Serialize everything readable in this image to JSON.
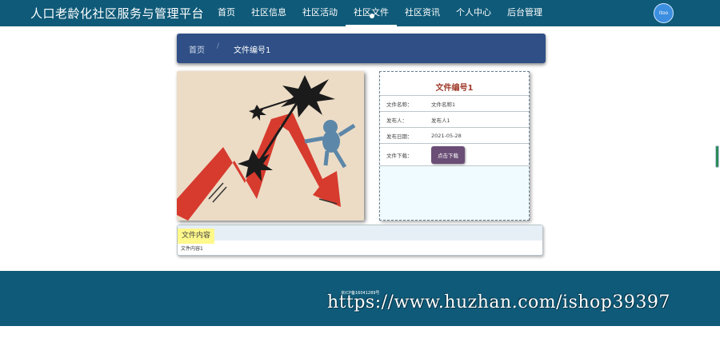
{
  "header": {
    "site_title": "人口老龄化社区服务与管理平台",
    "nav": [
      "首页",
      "社区信息",
      "社区活动",
      "社区文件",
      "社区资讯",
      "个人中心",
      "后台管理"
    ],
    "active_nav": "社区文件",
    "avatar_text": "itoo"
  },
  "breadcrumb": {
    "home": "首页",
    "separator": "/",
    "current": "文件编号1"
  },
  "detail": {
    "title": "文件编号1",
    "rows": [
      {
        "label": "文件名称：",
        "value": "文件名称1"
      },
      {
        "label": "发布人：",
        "value": "发布人1"
      },
      {
        "label": "发布日期：",
        "value": "2021-05-28"
      }
    ],
    "download_label": "文件下载：",
    "download_button": "点击下载"
  },
  "content": {
    "tab": "文件内容",
    "text": "文件内容1"
  },
  "footer": {
    "icp": "京ICP备16041289号",
    "watermark": "https://www.huzhan.com/ishop39397"
  },
  "colors": {
    "header_bg": "#0f5a78",
    "breadcrumb_bg": "#2f4f86",
    "title_red": "#a03b2c",
    "download_btn": "#6a4e76",
    "tab_yellow": "#fff88a"
  }
}
